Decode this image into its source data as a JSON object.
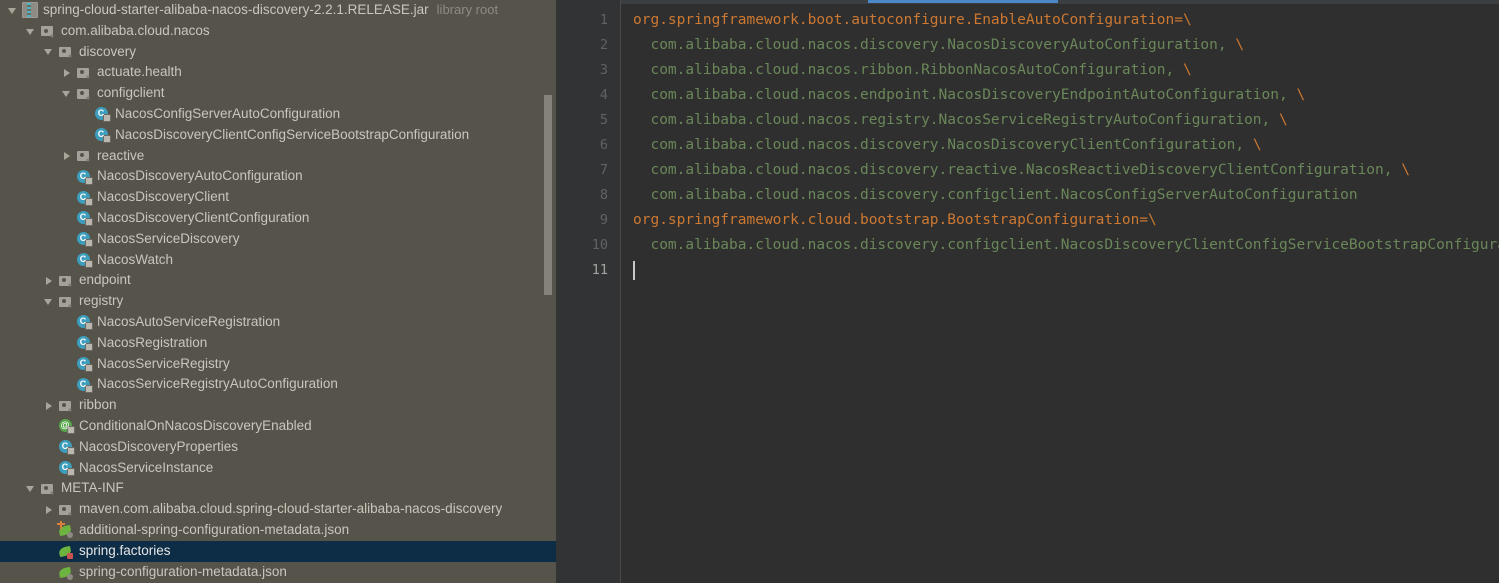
{
  "tree": {
    "panel_name": "project-library-tree",
    "nodes": [
      {
        "label": "spring-cloud-starter-alibaba-nacos-discovery-2.2.1.RELEASE.jar",
        "sub": "library root",
        "indent": 0,
        "arrow": "expanded",
        "icon": "jar-icon",
        "selected": false
      },
      {
        "label": "com.alibaba.cloud.nacos",
        "sub": "",
        "indent": 1,
        "arrow": "expanded",
        "icon": "package-icon",
        "selected": false
      },
      {
        "label": "discovery",
        "sub": "",
        "indent": 2,
        "arrow": "expanded",
        "icon": "package-icon",
        "selected": false
      },
      {
        "label": "actuate.health",
        "sub": "",
        "indent": 3,
        "arrow": "collapsed",
        "icon": "package-icon",
        "selected": false
      },
      {
        "label": "configclient",
        "sub": "",
        "indent": 3,
        "arrow": "expanded",
        "icon": "package-icon",
        "selected": false
      },
      {
        "label": "NacosConfigServerAutoConfiguration",
        "sub": "",
        "indent": 4,
        "arrow": "none",
        "icon": "class-icon",
        "selected": false
      },
      {
        "label": "NacosDiscoveryClientConfigServiceBootstrapConfiguration",
        "sub": "",
        "indent": 4,
        "arrow": "none",
        "icon": "class-icon",
        "selected": false
      },
      {
        "label": "reactive",
        "sub": "",
        "indent": 3,
        "arrow": "collapsed",
        "icon": "package-icon",
        "selected": false
      },
      {
        "label": "NacosDiscoveryAutoConfiguration",
        "sub": "",
        "indent": 3,
        "arrow": "none",
        "icon": "class-icon",
        "selected": false
      },
      {
        "label": "NacosDiscoveryClient",
        "sub": "",
        "indent": 3,
        "arrow": "none",
        "icon": "class-icon",
        "selected": false
      },
      {
        "label": "NacosDiscoveryClientConfiguration",
        "sub": "",
        "indent": 3,
        "arrow": "none",
        "icon": "class-icon",
        "selected": false
      },
      {
        "label": "NacosServiceDiscovery",
        "sub": "",
        "indent": 3,
        "arrow": "none",
        "icon": "class-icon",
        "selected": false
      },
      {
        "label": "NacosWatch",
        "sub": "",
        "indent": 3,
        "arrow": "none",
        "icon": "class-icon",
        "selected": false
      },
      {
        "label": "endpoint",
        "sub": "",
        "indent": 2,
        "arrow": "collapsed",
        "icon": "package-icon",
        "selected": false
      },
      {
        "label": "registry",
        "sub": "",
        "indent": 2,
        "arrow": "expanded",
        "icon": "package-icon",
        "selected": false
      },
      {
        "label": "NacosAutoServiceRegistration",
        "sub": "",
        "indent": 3,
        "arrow": "none",
        "icon": "class-icon",
        "selected": false
      },
      {
        "label": "NacosRegistration",
        "sub": "",
        "indent": 3,
        "arrow": "none",
        "icon": "class-icon",
        "selected": false
      },
      {
        "label": "NacosServiceRegistry",
        "sub": "",
        "indent": 3,
        "arrow": "none",
        "icon": "class-icon",
        "selected": false
      },
      {
        "label": "NacosServiceRegistryAutoConfiguration",
        "sub": "",
        "indent": 3,
        "arrow": "none",
        "icon": "class-icon",
        "selected": false
      },
      {
        "label": "ribbon",
        "sub": "",
        "indent": 2,
        "arrow": "collapsed",
        "icon": "package-icon",
        "selected": false
      },
      {
        "label": "ConditionalOnNacosDiscoveryEnabled",
        "sub": "",
        "indent": 2,
        "arrow": "none",
        "icon": "annotation-icon",
        "selected": false
      },
      {
        "label": "NacosDiscoveryProperties",
        "sub": "",
        "indent": 2,
        "arrow": "none",
        "icon": "class-icon",
        "selected": false
      },
      {
        "label": "NacosServiceInstance",
        "sub": "",
        "indent": 2,
        "arrow": "none",
        "icon": "class-icon",
        "selected": false
      },
      {
        "label": "META-INF",
        "sub": "",
        "indent": 1,
        "arrow": "expanded",
        "icon": "package-icon",
        "selected": false
      },
      {
        "label": "maven.com.alibaba.cloud.spring-cloud-starter-alibaba-nacos-discovery",
        "sub": "",
        "indent": 2,
        "arrow": "collapsed",
        "icon": "package-icon",
        "selected": false
      },
      {
        "label": "additional-spring-configuration-metadata.json",
        "sub": "",
        "indent": 2,
        "arrow": "none",
        "icon": "spring-metadata-icon",
        "selected": false
      },
      {
        "label": "spring.factories",
        "sub": "",
        "indent": 2,
        "arrow": "none",
        "icon": "spring-factories-icon",
        "selected": true
      },
      {
        "label": "spring-configuration-metadata.json",
        "sub": "",
        "indent": 2,
        "arrow": "none",
        "icon": "spring-metadata-icon",
        "selected": false
      }
    ]
  },
  "editor": {
    "panel_name": "spring-factories-editor",
    "lines": [
      {
        "num": "1",
        "segments": [
          {
            "t": "org.springframework.boot.autoconfigure.EnableAutoConfiguration=\\",
            "c": "k"
          }
        ],
        "current": false
      },
      {
        "num": "2",
        "segments": [
          {
            "t": "  com.alibaba.cloud.nacos.discovery.NacosDiscoveryAutoConfiguration,",
            "c": "v"
          },
          {
            "t": " \\",
            "c": "k"
          }
        ],
        "current": false
      },
      {
        "num": "3",
        "segments": [
          {
            "t": "  com.alibaba.cloud.nacos.ribbon.RibbonNacosAutoConfiguration,",
            "c": "v"
          },
          {
            "t": " \\",
            "c": "k"
          }
        ],
        "current": false
      },
      {
        "num": "4",
        "segments": [
          {
            "t": "  com.alibaba.cloud.nacos.endpoint.NacosDiscoveryEndpointAutoConfiguration,",
            "c": "v"
          },
          {
            "t": " \\",
            "c": "k"
          }
        ],
        "current": false
      },
      {
        "num": "5",
        "segments": [
          {
            "t": "  com.alibaba.cloud.nacos.registry.NacosServiceRegistryAutoConfiguration,",
            "c": "v"
          },
          {
            "t": " \\",
            "c": "k"
          }
        ],
        "current": false
      },
      {
        "num": "6",
        "segments": [
          {
            "t": "  com.alibaba.cloud.nacos.discovery.NacosDiscoveryClientConfiguration,",
            "c": "v"
          },
          {
            "t": " \\",
            "c": "k"
          }
        ],
        "current": false
      },
      {
        "num": "7",
        "segments": [
          {
            "t": "  com.alibaba.cloud.nacos.discovery.reactive.NacosReactiveDiscoveryClientConfiguration,",
            "c": "v"
          },
          {
            "t": " \\",
            "c": "k"
          }
        ],
        "current": false
      },
      {
        "num": "8",
        "segments": [
          {
            "t": "  com.alibaba.cloud.nacos.discovery.configclient.NacosConfigServerAutoConfiguration",
            "c": "v"
          }
        ],
        "current": false
      },
      {
        "num": "9",
        "segments": [
          {
            "t": "org.springframework.cloud.bootstrap.BootstrapConfiguration=\\",
            "c": "k"
          }
        ],
        "current": false
      },
      {
        "num": "10",
        "segments": [
          {
            "t": "  com.alibaba.cloud.nacos.discovery.configclient.NacosDiscoveryClientConfigServiceBootstrapConfiguration",
            "c": "v"
          }
        ],
        "current": false
      },
      {
        "num": "11",
        "segments": [],
        "current": true
      }
    ]
  },
  "colors": {
    "tree_background": "#56544a",
    "tree_selection": "#0d2c45",
    "editor_background": "#2f2f2f",
    "gutter_background": "#313335",
    "tab_accent": "#4a88c7",
    "key_color": "#cc7832",
    "value_color": "#6a8759"
  }
}
